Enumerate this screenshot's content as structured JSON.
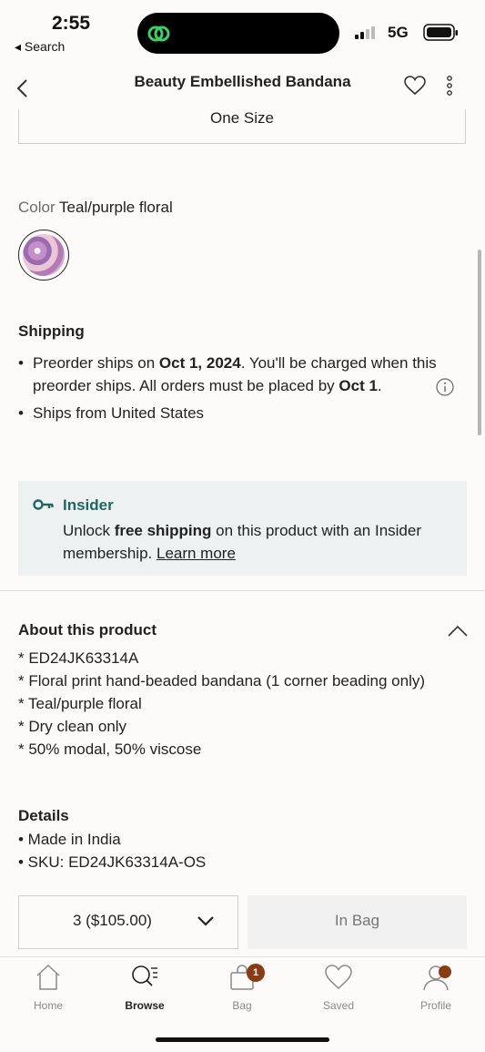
{
  "status_bar": {
    "time": "2:55",
    "back_label": "◂ Search",
    "network": "5G"
  },
  "header": {
    "title": "Beauty Embellished Bandana"
  },
  "size": {
    "selected": "One Size"
  },
  "color": {
    "label": "Color",
    "value": "Teal/purple floral"
  },
  "shipping": {
    "heading": "Shipping",
    "preorder_prefix": "Preorder ships on ",
    "preorder_date": "Oct 1, 2024",
    "preorder_middle": ". You'll be charged when this preorder ships. All orders must be placed by ",
    "preorder_deadline": "Oct 1",
    "preorder_suffix": ".",
    "ships_from": "Ships from United States"
  },
  "insider": {
    "title": "Insider",
    "text_prefix": "Unlock ",
    "text_bold": "free shipping",
    "text_suffix": " on this product with an Insider membership. ",
    "link": "Learn more",
    "accent": "#1d6760"
  },
  "about": {
    "heading": "About this product",
    "lines": [
      "* ED24JK63314A",
      "* Floral print hand-beaded bandana (1 corner beading only)",
      "* Teal/purple floral",
      "* Dry clean only",
      "* 50% modal, 50% viscose"
    ]
  },
  "details": {
    "heading": "Details",
    "lines": [
      "• Made in India",
      "• SKU: ED24JK63314A-OS"
    ]
  },
  "actions": {
    "quantity": "3 ($105.00)",
    "in_bag": "In Bag"
  },
  "tabbar": {
    "items": [
      {
        "label": "Home",
        "icon": "home-icon"
      },
      {
        "label": "Browse",
        "icon": "browse-icon",
        "active": true
      },
      {
        "label": "Bag",
        "icon": "bag-icon"
      },
      {
        "label": "Saved",
        "icon": "heart-icon"
      },
      {
        "label": "Profile",
        "icon": "profile-icon"
      }
    ],
    "bag_count": "1",
    "badge_color": "#8a3b12"
  }
}
